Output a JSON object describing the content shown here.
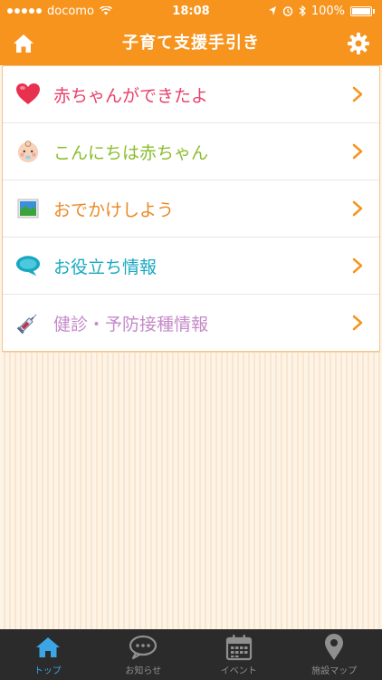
{
  "status_bar": {
    "carrier": "docomo",
    "time": "18:08",
    "battery": "100%"
  },
  "header": {
    "title": "子育て支援手引き"
  },
  "menu": {
    "items": [
      {
        "label": "赤ちゃんができたよ",
        "color": "#e8416b",
        "icon": "heart-icon"
      },
      {
        "label": "こんにちは赤ちゃん",
        "color": "#8cbd2e",
        "icon": "baby-face-icon"
      },
      {
        "label": "おでかけしよう",
        "color": "#e98a26",
        "icon": "landscape-icon"
      },
      {
        "label": "お役立ち情報",
        "color": "#18a9c2",
        "icon": "speech-bubble-icon"
      },
      {
        "label": "健診・予防接種情報",
        "color": "#c58ac9",
        "icon": "syringe-icon"
      }
    ]
  },
  "tabs": [
    {
      "label": "トップ",
      "icon": "home-icon",
      "active": true
    },
    {
      "label": "お知らせ",
      "icon": "chat-icon",
      "active": false
    },
    {
      "label": "イベント",
      "icon": "calendar-icon",
      "active": false
    },
    {
      "label": "施設マップ",
      "icon": "map-pin-icon",
      "active": false
    }
  ],
  "colors": {
    "brand": "#f7941d",
    "chevron": "#f7941d",
    "tab_active": "#3aa6e6",
    "tab_bar": "#2b2b2b"
  }
}
